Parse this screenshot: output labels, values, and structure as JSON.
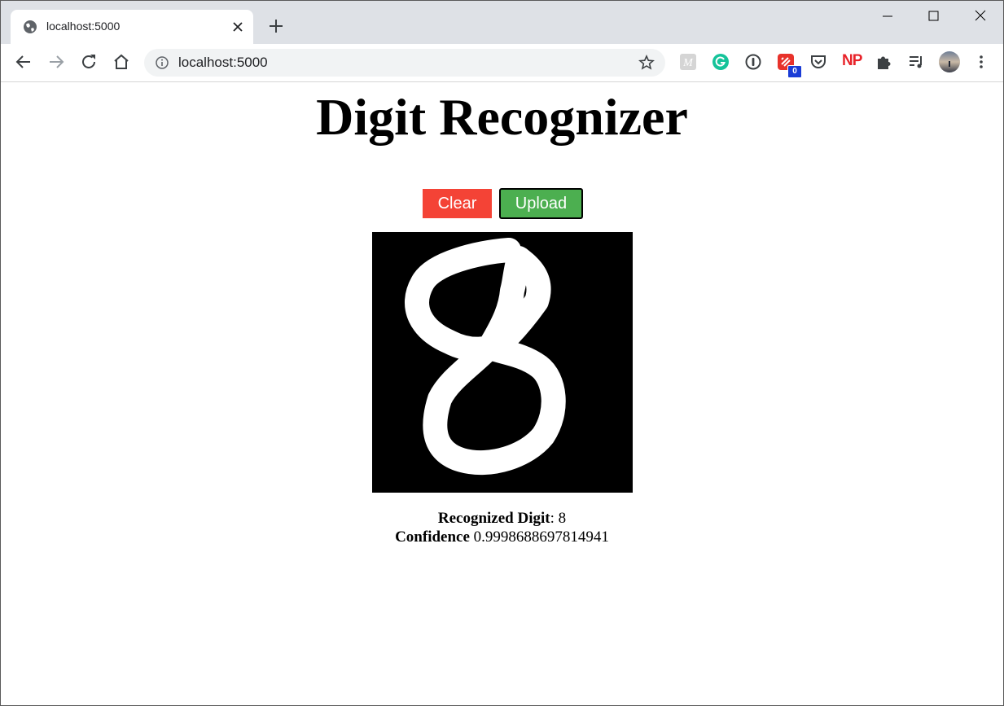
{
  "browser": {
    "tab": {
      "title": "localhost:5000"
    },
    "address": {
      "url": "localhost:5000"
    },
    "extension_badge": "0",
    "extension_np_label": "NP",
    "extension_m_label": "M"
  },
  "page": {
    "title": "Digit Recognizer",
    "buttons": {
      "clear": "Clear",
      "upload": "Upload"
    },
    "result": {
      "digit_label": "Recognized Digit",
      "digit_value": ": 8",
      "confidence_label": "Confidence",
      "confidence_value": " 0.9998688697814941"
    }
  },
  "colors": {
    "clear_button": "#f44336",
    "upload_button": "#4caf50",
    "canvas_background": "#000000",
    "stroke": "#ffffff"
  }
}
